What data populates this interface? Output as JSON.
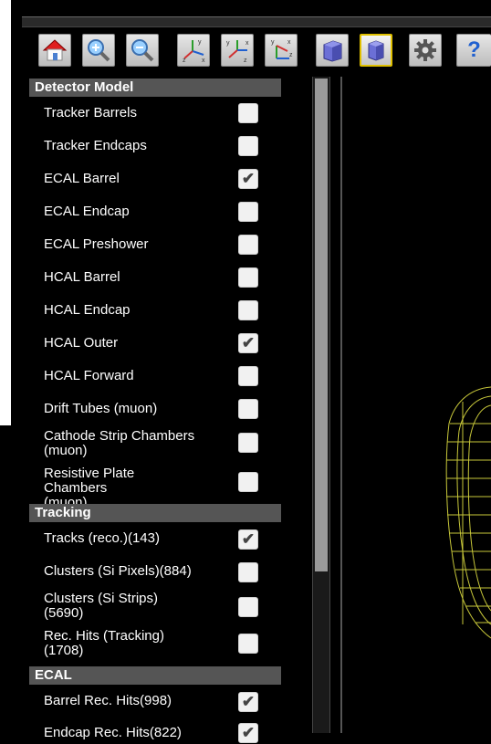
{
  "toolbar": {
    "buttons": [
      {
        "name": "home-icon"
      },
      {
        "name": "zoom-in-icon"
      },
      {
        "name": "zoom-out-icon"
      },
      {
        "name": "axes-xyz-view-icon"
      },
      {
        "name": "axes-zx-view-icon"
      },
      {
        "name": "axes-yz-view-icon"
      },
      {
        "name": "perspective-cube-icon"
      },
      {
        "name": "orthographic-cube-icon",
        "active": true
      },
      {
        "name": "gear-icon"
      },
      {
        "name": "help-icon",
        "glyph": "?"
      }
    ]
  },
  "panel": {
    "sections": [
      {
        "title": "Detector Model",
        "items": [
          {
            "label": "Tracker Barrels",
            "checked": false
          },
          {
            "label": "Tracker Endcaps",
            "checked": false
          },
          {
            "label": "ECAL Barrel",
            "checked": true
          },
          {
            "label": "ECAL Endcap",
            "checked": false
          },
          {
            "label": "ECAL Preshower",
            "checked": false
          },
          {
            "label": "HCAL Barrel",
            "checked": false
          },
          {
            "label": "HCAL Endcap",
            "checked": false
          },
          {
            "label": "HCAL Outer",
            "checked": true
          },
          {
            "label": "HCAL Forward",
            "checked": false
          },
          {
            "label": "Drift Tubes (muon)",
            "checked": false
          },
          {
            "label": "Cathode Strip Chambers (muon)",
            "checked": false
          },
          {
            "label": "Resistive Plate Chambers (muon)",
            "checked": false
          }
        ]
      },
      {
        "title": "Tracking",
        "items": [
          {
            "label": "Tracks (reco.)(143)",
            "checked": true
          },
          {
            "label": "Clusters (Si Pixels)(884)",
            "checked": false
          },
          {
            "label": "Clusters (Si Strips) (5690)",
            "checked": false
          },
          {
            "label": "Rec. Hits (Tracking) (1708)",
            "checked": false
          }
        ]
      },
      {
        "title": "ECAL",
        "items": [
          {
            "label": "Barrel Rec. Hits(998)",
            "checked": true
          },
          {
            "label": "Endcap Rec. Hits(822)",
            "checked": true
          }
        ]
      }
    ]
  },
  "colors": {
    "section_header_bg": "#555555",
    "wireframe": "#c8c83a",
    "active_button_border": "#e0c000"
  }
}
